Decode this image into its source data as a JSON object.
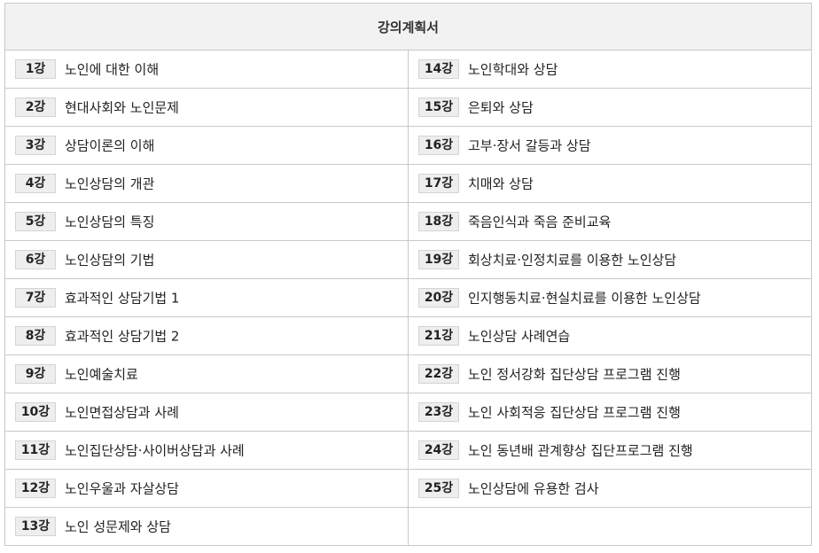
{
  "title": "강의계획서",
  "left": [
    {
      "num": "1강",
      "topic": "노인에 대한 이해"
    },
    {
      "num": "2강",
      "topic": "현대사회와 노인문제"
    },
    {
      "num": "3강",
      "topic": "상담이론의 이해"
    },
    {
      "num": "4강",
      "topic": "노인상담의 개관"
    },
    {
      "num": "5강",
      "topic": "노인상담의 특징"
    },
    {
      "num": "6강",
      "topic": "노인상담의 기법"
    },
    {
      "num": "7강",
      "topic": "효과적인 상담기법 1"
    },
    {
      "num": "8강",
      "topic": "효과적인 상담기법 2"
    },
    {
      "num": "9강",
      "topic": "노인예술치료"
    },
    {
      "num": "10강",
      "topic": "노인면접상담과 사례"
    },
    {
      "num": "11강",
      "topic": "노인집단상담·사이버상담과 사례"
    },
    {
      "num": "12강",
      "topic": "노인우울과 자살상담"
    },
    {
      "num": "13강",
      "topic": "노인 성문제와 상담"
    }
  ],
  "right": [
    {
      "num": "14강",
      "topic": "노인학대와 상담"
    },
    {
      "num": "15강",
      "topic": "은퇴와 상담"
    },
    {
      "num": "16강",
      "topic": "고부·장서 갈등과 상담"
    },
    {
      "num": "17강",
      "topic": "치매와 상담"
    },
    {
      "num": "18강",
      "topic": "죽음인식과 죽음 준비교육"
    },
    {
      "num": "19강",
      "topic": "회상치료·인정치료를 이용한 노인상담"
    },
    {
      "num": "20강",
      "topic": "인지행동치료·현실치료를 이용한 노인상담"
    },
    {
      "num": "21강",
      "topic": "노인상담 사례연습"
    },
    {
      "num": "22강",
      "topic": "노인 정서강화 집단상담 프로그램 진행"
    },
    {
      "num": "23강",
      "topic": "노인 사회적응 집단상담 프로그램 진행"
    },
    {
      "num": "24강",
      "topic": "노인 동년배 관계향상 집단프로그램 진행"
    },
    {
      "num": "25강",
      "topic": "노인상담에 유용한 검사"
    }
  ]
}
